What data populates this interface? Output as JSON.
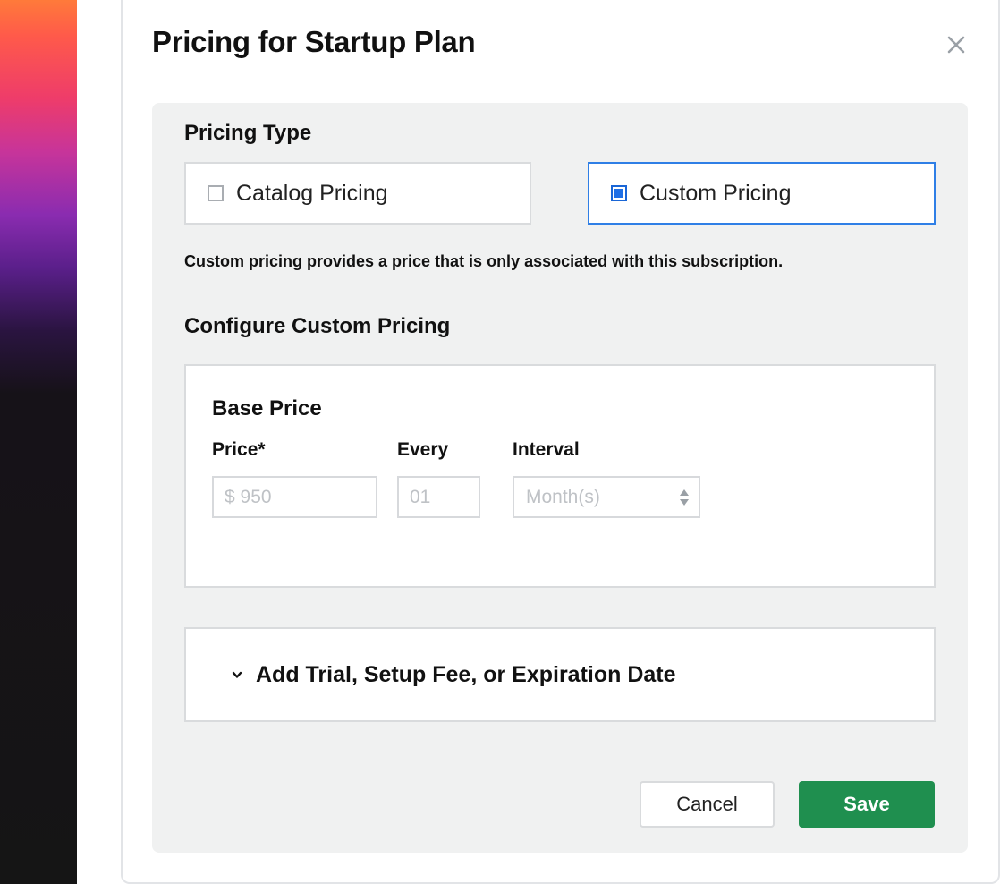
{
  "dialog": {
    "title": "Pricing for Startup Plan",
    "close_icon": "close-icon"
  },
  "pricing_type": {
    "heading": "Pricing Type",
    "options": [
      {
        "label": "Catalog Pricing",
        "selected": false
      },
      {
        "label": "Custom Pricing",
        "selected": true
      }
    ],
    "helper_text": "Custom pricing provides a price that is only associated with this subscription."
  },
  "configure": {
    "heading": "Configure Custom Pricing",
    "base_price": {
      "title": "Base Price",
      "price_label": "Price*",
      "price_value": "$ 950",
      "every_label": "Every",
      "every_value": "01",
      "interval_label": "Interval",
      "interval_value": "Month(s)"
    }
  },
  "expander": {
    "label": "Add Trial, Setup Fee, or Expiration Date",
    "icon": "chevron-down-icon"
  },
  "actions": {
    "cancel_label": "Cancel",
    "save_label": "Save"
  },
  "colors": {
    "accent": "#2f7fe6",
    "primary_button": "#1f8f4f",
    "panel_background": "#f0f1f1"
  }
}
